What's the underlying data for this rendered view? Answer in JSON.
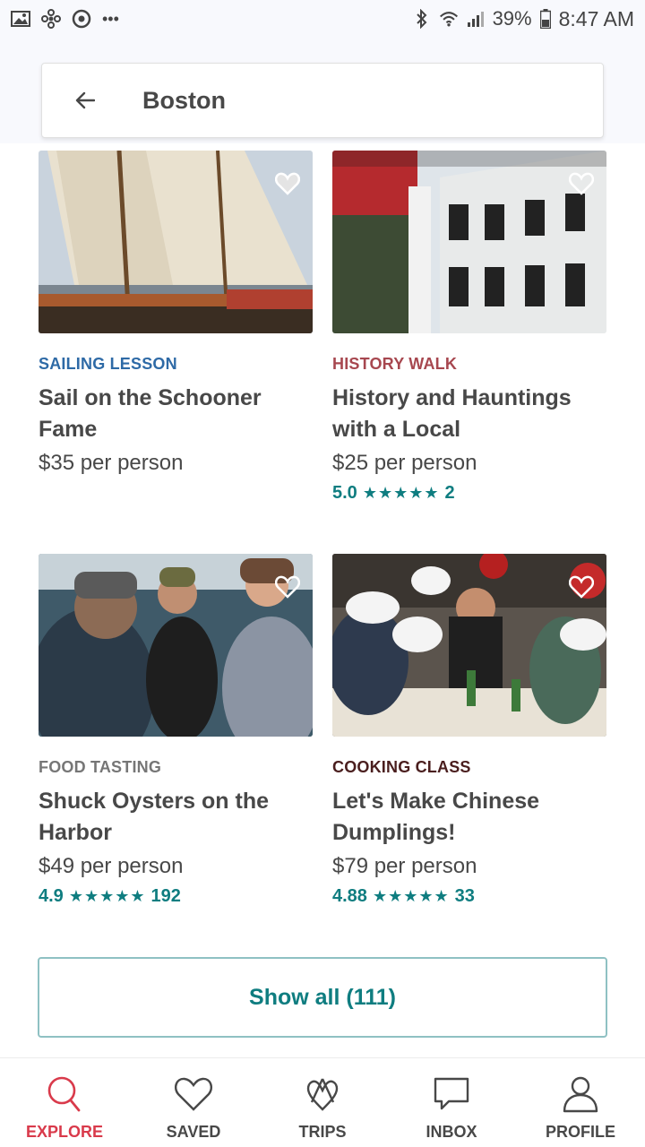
{
  "status_bar": {
    "left_icons": [
      "gallery-icon",
      "fan-icon",
      "sync-icon",
      "more-dots-icon"
    ],
    "more_dots": "•••",
    "battery": "39%",
    "time": "8:47 AM"
  },
  "search": {
    "title": "Boston"
  },
  "cards": [
    {
      "category": "SAILING LESSON",
      "category_color": "#2e6aa6",
      "title": "Sail on the Schooner Fame",
      "price": "$35 per person",
      "rating": "",
      "stars": "",
      "reviews": ""
    },
    {
      "category": "HISTORY WALK",
      "category_color": "#a7474f",
      "title": "History and Hauntings with a Local",
      "price": "$25 per person",
      "rating": "5.0",
      "stars": "★★★★★",
      "reviews": "2"
    },
    {
      "category": "FOOD TASTING",
      "category_color": "#767676",
      "title": "Shuck Oysters on the Harbor",
      "price": "$49 per person",
      "rating": "4.9",
      "stars": "★★★★★",
      "reviews": "192"
    },
    {
      "category": "COOKING CLASS",
      "category_color": "#4a1e1e",
      "title": "Let's Make Chinese Dumplings!",
      "price": "$79 per person",
      "rating": "4.88",
      "stars": "★★★★★",
      "reviews": "33"
    }
  ],
  "show_all": "Show all (111)",
  "nav": [
    {
      "label": "EXPLORE",
      "icon": "search-icon",
      "active": true
    },
    {
      "label": "SAVED",
      "icon": "heart-icon",
      "active": false
    },
    {
      "label": "TRIPS",
      "icon": "airbnb-logo-icon",
      "active": false
    },
    {
      "label": "INBOX",
      "icon": "chat-bubble-icon",
      "active": false
    },
    {
      "label": "PROFILE",
      "icon": "person-icon",
      "active": false
    }
  ],
  "colors": {
    "accent": "#0f7d80",
    "active_nav": "#d93a4b",
    "text": "#484848"
  }
}
